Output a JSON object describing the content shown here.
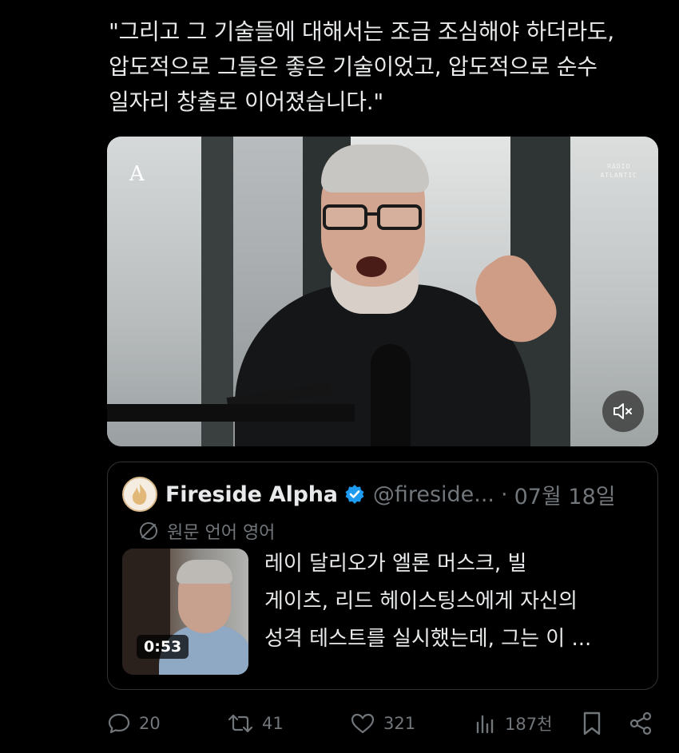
{
  "tweet": {
    "text_lines": [
      "\"그리고 그 기술들에 대해서는 조금 조심해야 하더라도,",
      "압도적으로 그들은 좋은 기술이었고, 압도적으로 순수",
      "일자리 창출로 이어졌습니다.\""
    ]
  },
  "video": {
    "brand_mark": "A",
    "watermark_line1": "RADIO",
    "watermark_line2": "ATLANTIC",
    "mute_icon": "speaker-muted-icon"
  },
  "quote": {
    "name": "Fireside Alpha",
    "handle": "@fireside...",
    "separator": "·",
    "date": "07월 18일",
    "translate_label": "원문 언어 영어",
    "text_lines": [
      "레이 달리오가 엘론 머스크, 빌",
      "게이츠, 리드 헤이스팅스에게 자신의",
      "성격 테스트를 실시했는데, 그는 이 ..."
    ],
    "video_duration": "0:53",
    "colors": {
      "verified": "#1d9bf0",
      "muted_text": "#71767b"
    }
  },
  "actions": {
    "reply_count": "20",
    "retweet_count": "41",
    "like_count": "321",
    "views_count": "187천"
  }
}
